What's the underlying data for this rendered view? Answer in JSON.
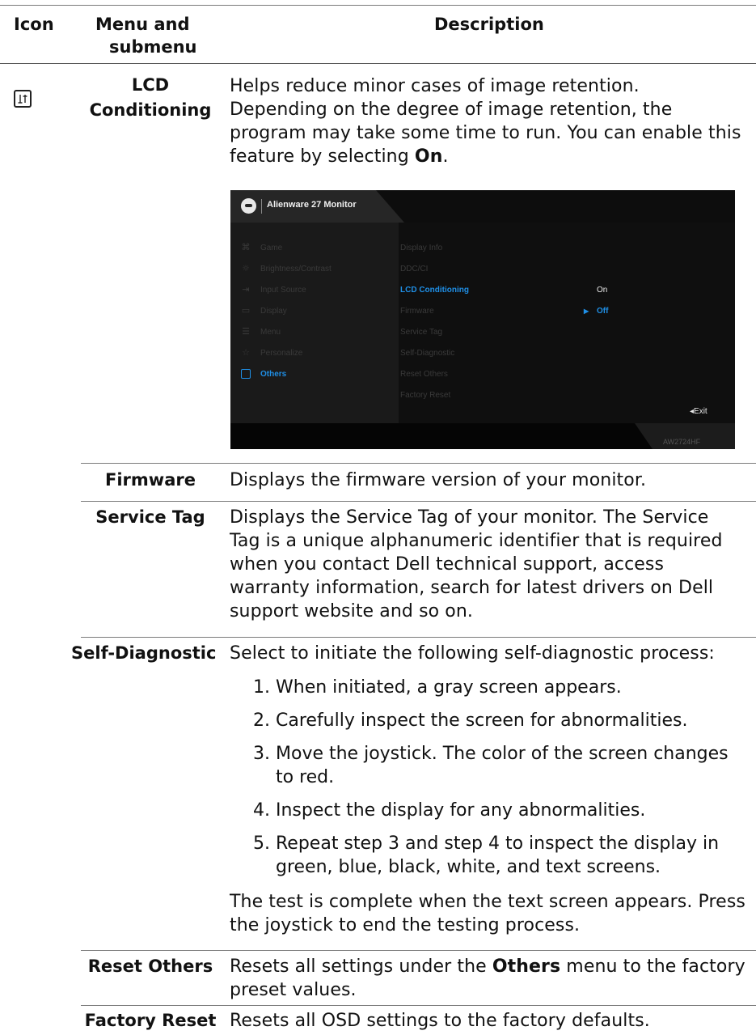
{
  "header": {
    "icon": "Icon",
    "menu_line1": "Menu and",
    "menu_line2": "submenu",
    "description": "Description"
  },
  "rows": {
    "lcd": {
      "icon": "others-icon",
      "name_line1": "LCD",
      "name_line2": "Conditioning",
      "desc_line1": "Helps reduce minor cases of image retention.",
      "desc_line2": "Depending on the degree of image retention, the",
      "desc_line3": "program may take some time to run. You can enable this",
      "desc_line4_pre": "feature by selecting ",
      "desc_line4_bold": "On",
      "desc_line4_post": "."
    },
    "firmware": {
      "name": "Firmware",
      "desc": "Displays the firmware version of your monitor."
    },
    "service_tag": {
      "name": "Service Tag",
      "desc_line1": "Displays the Service Tag of your monitor. The Service",
      "desc_line2": "Tag is a unique alphanumeric identifier that is required",
      "desc_line3": "when you contact Dell technical support, access",
      "desc_line4": "warranty information, search for latest drivers on Dell",
      "desc_line5": "support website and so on."
    },
    "self_diag": {
      "name": "Self-Diagnostic",
      "intro": "Select to initiate the following self-diagnostic process:",
      "steps": [
        {
          "num": "1.",
          "line1": "When initiated, a gray screen appears.",
          "line2": ""
        },
        {
          "num": "2.",
          "line1": "Carefully inspect the screen for abnormalities.",
          "line2": ""
        },
        {
          "num": "3.",
          "line1": "Move the joystick. The color of the screen changes",
          "line2": "to red."
        },
        {
          "num": "4.",
          "line1": "Inspect the display for any abnormalities.",
          "line2": ""
        },
        {
          "num": "5.",
          "line1": "Repeat step 3 and step 4 to inspect the display in",
          "line2": "green, blue, black, white, and text screens."
        }
      ],
      "outro_line1": "The test is complete when the text screen appears. Press",
      "outro_line2": "the joystick to end the testing process."
    },
    "reset_others": {
      "name": "Reset Others",
      "desc_pre": "Resets all settings under the ",
      "desc_bold": "Others",
      "desc_post": " menu to the factory",
      "desc_line2": "preset values."
    },
    "factory_reset": {
      "name": "Factory Reset",
      "desc": "Resets all OSD settings to the factory defaults."
    }
  },
  "osd": {
    "title": "Alienware 27 Monitor",
    "model": "AW2724HF",
    "exit": "◂Exit",
    "accent_color": "#1f8fe6",
    "left_menu": [
      {
        "label": "Game",
        "icon": "gamepad-icon"
      },
      {
        "label": "Brightness/Contrast",
        "icon": "brightness-icon"
      },
      {
        "label": "Input Source",
        "icon": "input-source-icon"
      },
      {
        "label": "Display",
        "icon": "display-icon"
      },
      {
        "label": "Menu",
        "icon": "menu-icon"
      },
      {
        "label": "Personalize",
        "icon": "star-icon"
      },
      {
        "label": "Others",
        "icon": "others-icon",
        "active": true
      }
    ],
    "sub_menu": [
      {
        "label": "Display Info"
      },
      {
        "label": "DDC/CI"
      },
      {
        "label": "LCD Conditioning",
        "active": true
      },
      {
        "label": "Firmware"
      },
      {
        "label": "Service Tag"
      },
      {
        "label": "Self-Diagnostic"
      },
      {
        "label": "Reset Others"
      },
      {
        "label": "Factory Reset"
      }
    ],
    "options": [
      {
        "label": "On"
      },
      {
        "label": "Off",
        "selected": true
      }
    ],
    "selected_marker": "▶"
  }
}
